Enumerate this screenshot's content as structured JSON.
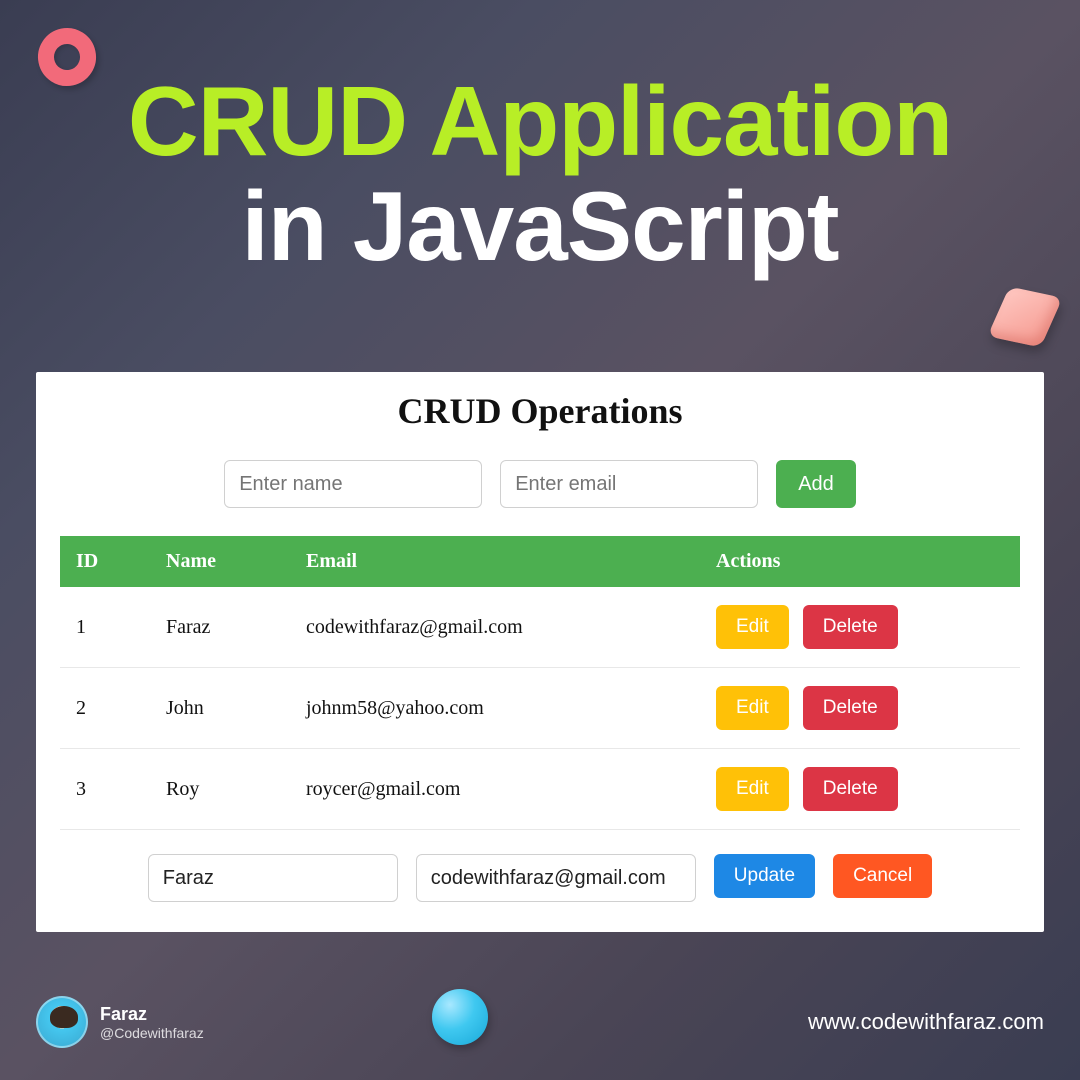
{
  "hero": {
    "line1": "CRUD Application",
    "line2": "in JavaScript"
  },
  "card": {
    "title": "CRUD Operations",
    "name_placeholder": "Enter name",
    "email_placeholder": "Enter email",
    "add_label": "Add",
    "columns": {
      "id": "ID",
      "name": "Name",
      "email": "Email",
      "actions": "Actions"
    },
    "edit_label": "Edit",
    "delete_label": "Delete",
    "rows": [
      {
        "id": "1",
        "name": "Faraz",
        "email": "codewithfaraz@gmail.com"
      },
      {
        "id": "2",
        "name": "John",
        "email": "johnm58@yahoo.com"
      },
      {
        "id": "3",
        "name": "Roy",
        "email": "roycer@gmail.com"
      }
    ],
    "edit_form": {
      "name_value": "Faraz",
      "email_value": "codewithfaraz@gmail.com",
      "update_label": "Update",
      "cancel_label": "Cancel"
    }
  },
  "footer": {
    "author_name": "Faraz",
    "author_handle": "@Codewithfaraz",
    "site": "www.codewithfaraz.com"
  },
  "colors": {
    "accent_lime": "#b8ee26",
    "table_green": "#4caf50",
    "edit_yellow": "#ffc107",
    "delete_red": "#dc3545",
    "update_blue": "#1e88e5",
    "cancel_orange": "#ff5722"
  }
}
